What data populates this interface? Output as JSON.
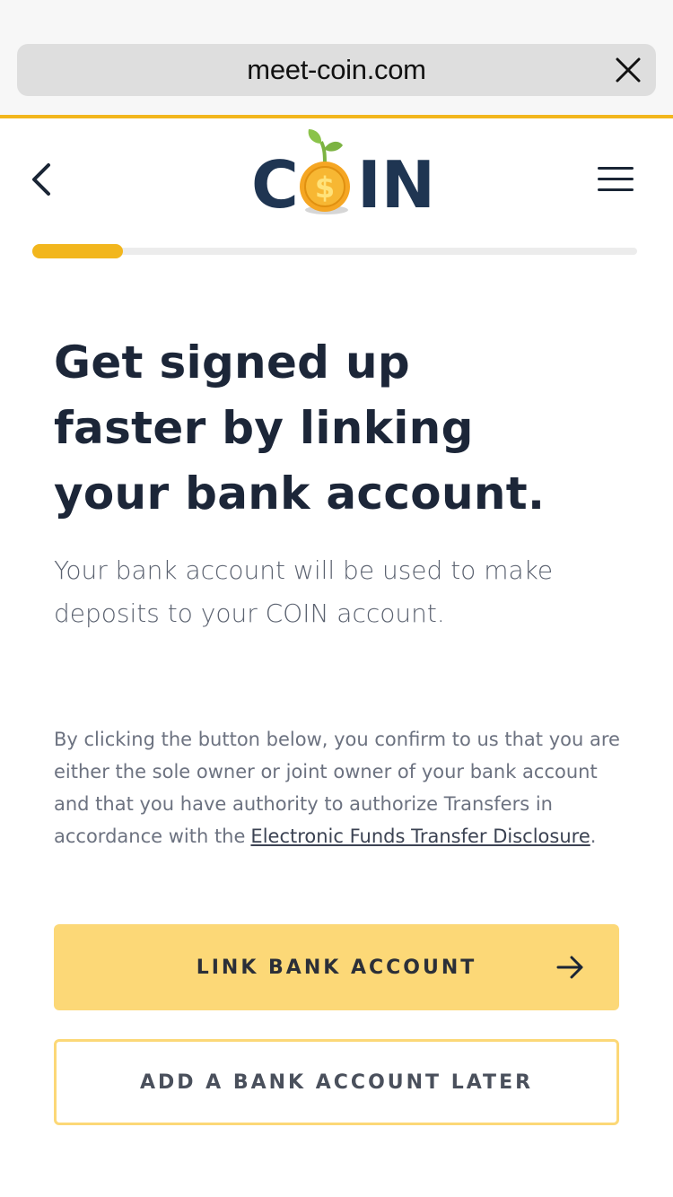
{
  "browser": {
    "url": "meet-coin.com",
    "close_icon": "close-icon"
  },
  "header": {
    "logo_left": "C",
    "logo_right": "IN",
    "back_icon": "chevron-left-icon",
    "menu_icon": "hamburger-menu-icon"
  },
  "progress": {
    "fraction": 0.15
  },
  "main": {
    "headline": "Get signed up faster by linking your bank account.",
    "subtext": "Your bank account will be used to make deposits to your COIN account.",
    "disclaimer": "By clicking the button below, you confirm to us that you are either the sole owner or joint owner of your bank account and that you have authority to authorize Transfers in accordance with the",
    "disclaimer_link": "Electronic Funds Transfer Disclosure",
    "disclaimer_end": "."
  },
  "actions": {
    "primary_label": "LINK BANK ACCOUNT",
    "secondary_label": "ADD A BANK ACCOUNT LATER",
    "primary_icon": "arrow-right-icon"
  },
  "colors": {
    "accent": "#f2b61d",
    "button_fill": "#fcd877",
    "text_dark": "#1c2638",
    "logo_navy": "#1f3552"
  }
}
